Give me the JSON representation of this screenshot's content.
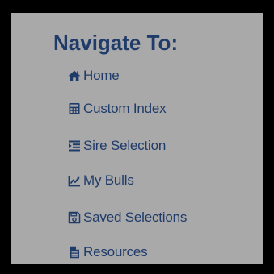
{
  "nav": {
    "title": "Navigate To:",
    "items": [
      {
        "label": "Home",
        "icon": "home-icon"
      },
      {
        "label": "Custom Index",
        "icon": "calculator-icon"
      },
      {
        "label": "Sire Selection",
        "icon": "indent-list-icon"
      },
      {
        "label": "My Bulls",
        "icon": "line-chart-icon"
      },
      {
        "label": "Saved Selections",
        "icon": "save-icon"
      },
      {
        "label": "Resources",
        "icon": "document-icon"
      }
    ]
  },
  "colors": {
    "border": "#000000",
    "panel_background": "#a9a9a9",
    "text": "#1f3b6a"
  }
}
